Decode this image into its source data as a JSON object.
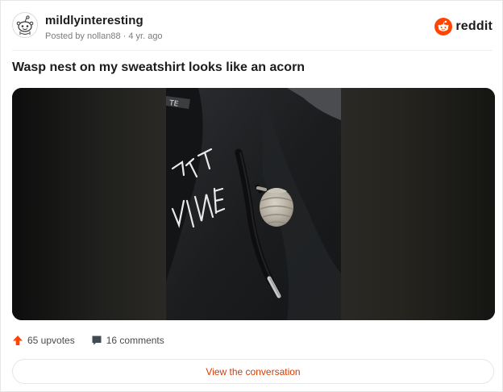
{
  "header": {
    "subreddit": "mildlyinteresting",
    "posted_by": "Posted by nollan88",
    "age": "4 yr. ago",
    "brand": "reddit",
    "brand_color": "#ff4500"
  },
  "post": {
    "title": "Wasp nest on my sweatshirt looks like an acorn",
    "media_icon": "photo-image"
  },
  "actions": {
    "upvotes": "65 upvotes",
    "comments": "16 comments",
    "upvote_icon": "arrow-up-icon",
    "comment_icon": "comment-bubble-icon"
  },
  "footer": {
    "view_label": "View the conversation"
  }
}
